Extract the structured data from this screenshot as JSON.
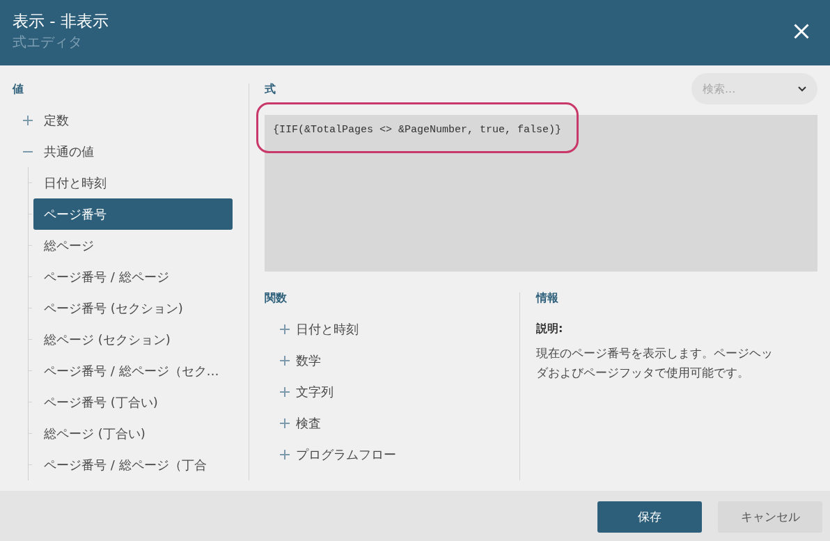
{
  "dialog": {
    "title": "表示 - 非表示",
    "subtitle": "式エディタ"
  },
  "values": {
    "heading": "値",
    "tree": [
      {
        "label": "定数",
        "expanded": false,
        "selected": false
      },
      {
        "label": "共通の値",
        "expanded": true,
        "selected": false,
        "children": [
          {
            "label": "日付と時刻",
            "selected": false
          },
          {
            "label": "ページ番号",
            "selected": true
          },
          {
            "label": "総ページ",
            "selected": false
          },
          {
            "label": "ページ番号 / 総ページ",
            "selected": false
          },
          {
            "label": "ページ番号 (セクション)",
            "selected": false
          },
          {
            "label": "総ページ (セクション)",
            "selected": false
          },
          {
            "label": "ページ番号 / 総ページ（セク…",
            "selected": false
          },
          {
            "label": "ページ番号 (丁合い)",
            "selected": false
          },
          {
            "label": "総ページ (丁合い)",
            "selected": false
          },
          {
            "label": "ページ番号 / 総ページ（丁合",
            "selected": false
          }
        ]
      }
    ]
  },
  "expression": {
    "heading": "式",
    "value": "{IIF(&TotalPages <> &PageNumber, true, false)}",
    "highlighted": true
  },
  "search": {
    "placeholder": "検索..."
  },
  "functions": {
    "heading": "関数",
    "items": [
      {
        "label": "日付と時刻",
        "expanded": false
      },
      {
        "label": "数学",
        "expanded": false
      },
      {
        "label": "文字列",
        "expanded": false
      },
      {
        "label": "検査",
        "expanded": false
      },
      {
        "label": "プログラムフロー",
        "expanded": false
      }
    ]
  },
  "info": {
    "heading": "情報",
    "label": "説明:",
    "description": "現在のページ番号を表示します。ページヘッダおよびページフッタで使用可能です。"
  },
  "buttons": [
    {
      "label": "保存",
      "kind": "primary"
    },
    {
      "label": "キャンセル",
      "kind": "secondary"
    }
  ]
}
